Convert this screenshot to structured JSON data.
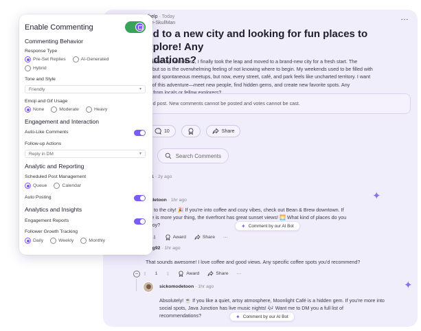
{
  "post": {
    "subreddit": "r/help",
    "time": "Today",
    "author": "The-SkullMan",
    "title_line1": "ved to a new city and looking for fun places to explore! Any",
    "title_line2": "endations?",
    "body_lines": [
      "g years in my hometown, I finally took the leap and moved to a brand-new city for a fresh start. The",
      "real, but so is the overwhelming feeling of not knowing where to begin. My weekends used to be filled with",
      "outs and spontaneous meetups, but now, every street, café, and park feels like uncharted territory. I want",
      "nost of this adventure—meet new people, find hidden gems, and create new favorite spots. Any",
      "tions from locals or fellow explorers?"
    ],
    "locked_note": "ved post. New comments cannot be posted and votes cannot be cast.",
    "comment_count": "10",
    "share_label": "Share",
    "more": "…"
  },
  "comments": {
    "search_placeholder": "Search Comments",
    "c1": {
      "user": "d1",
      "time": "2y ago"
    },
    "c2": {
      "user": "odetoon",
      "time": "1hr ago",
      "lines": [
        "me to the city! 🎉 If you're into coffee and cozy vibes, check out Bean & Brew downtown. If",
        "ture is more your thing, the riverfront has great sunset views! 🌅 What kind of places do you",
        " enjoy?"
      ],
      "award": "Award",
      "share": "Share",
      "more": "···"
    },
    "c3": {
      "user": "illg92",
      "time": "1hr ago",
      "text": "That sounds awesome! I love coffee and good views. Any specific coffee spots you'd recommend?",
      "votes": "1",
      "award": "Award",
      "share": "Share",
      "more": "···"
    },
    "c4": {
      "user": "sickomodetoon",
      "time": "1hr ago",
      "lines": [
        "Absolutely! ☕ If you like a quiet, artsy atmosphere, Moonlight Café is a hidden gem. If you're more into",
        "social spots, Java Junction has live music nights! 🎶 Want me to DM you a full list of",
        "recommendations?"
      ]
    },
    "ai_badge": "Comment by our AI Bot"
  },
  "panel": {
    "title": "Enable Commenting",
    "commenting_behavior": "Commenting Behavior",
    "response_type": {
      "label": "Response Type",
      "options": [
        "Pre-Set Replies",
        "AI-Generated",
        "Hybrid"
      ],
      "selected": "Pre-Set Replies"
    },
    "tone": {
      "label": "Tone and Style",
      "value": "Friendly"
    },
    "emoji": {
      "label": "Emoji and Gif Usage",
      "options": [
        "None",
        "Moderate",
        "Heavy"
      ],
      "selected": "None"
    },
    "engagement": "Engagement and Interaction",
    "auto_like": "Auto-Like Comments",
    "follow_up": {
      "label": "Follow-up Actions",
      "value": "Reply in DM"
    },
    "analytic": "Analytic and Reporting",
    "scheduled": {
      "label": "Scheduled Post Management",
      "options": [
        "Queue",
        "Calendar"
      ],
      "selected": "Queue"
    },
    "auto_posting": "Auto Posting",
    "insights": "Analytics and Insights",
    "engagement_reports": "Engagement Reports",
    "follower_growth": {
      "label": "Follower Growth Tracking",
      "options": [
        "Daily",
        "Weekly",
        "Monthly"
      ],
      "selected": "Daily"
    }
  },
  "colors": {
    "accent": "#7b5cf0",
    "toggle_on": "#3aa35a",
    "card_bg": "#f1eefc"
  }
}
